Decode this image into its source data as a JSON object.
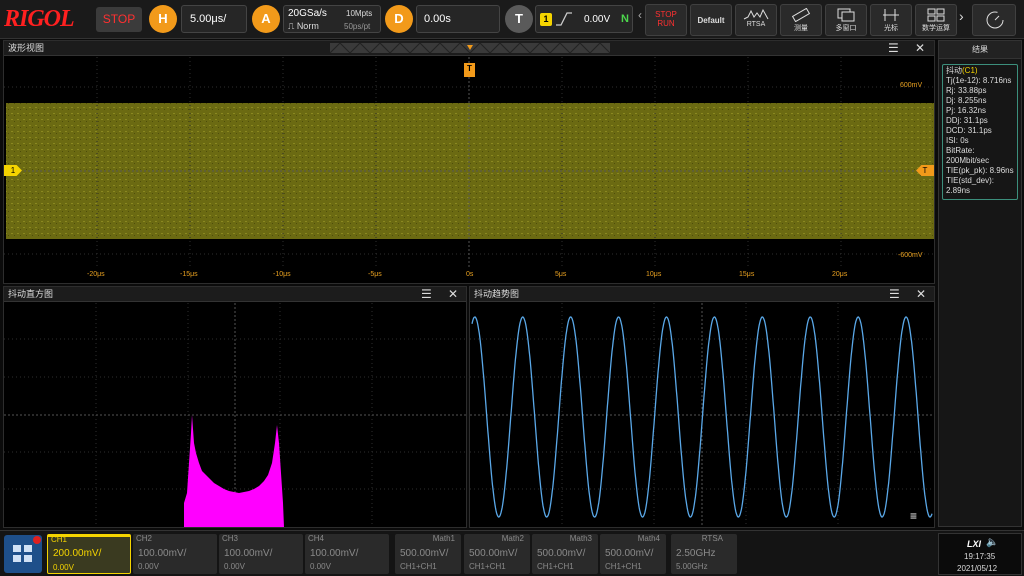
{
  "header": {
    "logo": "RIGOL",
    "run_state": "STOP",
    "horizontal": {
      "badge": "H",
      "timebase": "5.00μs/"
    },
    "acquire": {
      "badge": "A",
      "sample_rate": "20GSa/s",
      "mode": "Norm",
      "memory_depth": "10Mpts",
      "points": "50ps/pt"
    },
    "delay": {
      "badge": "D",
      "value": "0.00s"
    },
    "trigger": {
      "badge": "T",
      "source": "1",
      "level": "0.00V",
      "status": "N"
    },
    "buttons": [
      {
        "label": "STOP RUN"
      },
      {
        "label": "Default"
      },
      {
        "label": "RTSA"
      },
      {
        "label": "测量"
      },
      {
        "label": "多窗口"
      },
      {
        "label": "光标"
      },
      {
        "label": "数学运算"
      }
    ]
  },
  "waveform_panel": {
    "title": "波形视图",
    "y_top": "600mV",
    "y_bottom": "-600mV",
    "trigger_marker": "T",
    "channel_marker": "1",
    "x_ticks": [
      "-20μs",
      "-15μs",
      "-10μs",
      "-5μs",
      "0s",
      "5μs",
      "10μs",
      "15μs",
      "20μs"
    ]
  },
  "histogram_panel": {
    "title": "抖动直方图"
  },
  "trend_panel": {
    "title": "抖动趋势图"
  },
  "results": {
    "title": "结果",
    "header_prefix": "抖动",
    "header_channel": "(C1)",
    "items": [
      "Tj(1e-12): 8.716ns",
      "Rj: 33.88ps",
      "Dj: 8.255ns",
      "Pj: 16.32ns",
      "DDj: 31.1ps",
      "DCD: 31.1ps",
      "ISI: 0s",
      "BitRate: 200Mbit/sec",
      "TIE(pk_pk): 8.96ns",
      "TIE(std_dev): 2.89ns"
    ]
  },
  "channels": [
    {
      "name": "CH1",
      "scale": "200.00mV/",
      "offset": "0.00V",
      "active": true
    },
    {
      "name": "CH2",
      "scale": "100.00mV/",
      "offset": "0.00V",
      "active": false
    },
    {
      "name": "CH3",
      "scale": "100.00mV/",
      "offset": "0.00V",
      "active": false
    },
    {
      "name": "CH4",
      "scale": "100.00mV/",
      "offset": "0.00V",
      "active": false
    }
  ],
  "math": [
    {
      "name": "Math1",
      "scale": "500.00mV/",
      "source": "CH1+CH1"
    },
    {
      "name": "Math2",
      "scale": "500.00mV/",
      "source": "CH1+CH1"
    },
    {
      "name": "Math3",
      "scale": "500.00mV/",
      "source": "CH1+CH1"
    },
    {
      "name": "Math4",
      "scale": "500.00mV/",
      "source": "CH1+CH1"
    }
  ],
  "rtsa": {
    "name": "RTSA",
    "center": "2.50GHz",
    "span": "5.00GHz"
  },
  "status": {
    "time": "19:17:35",
    "date": "2021/05/12",
    "lxi": "LXI"
  },
  "colors": {
    "ch1": "#f5d400",
    "accent": "#f29a1a",
    "histogram": "#ff00ff",
    "trend": "#5aa8e8"
  }
}
